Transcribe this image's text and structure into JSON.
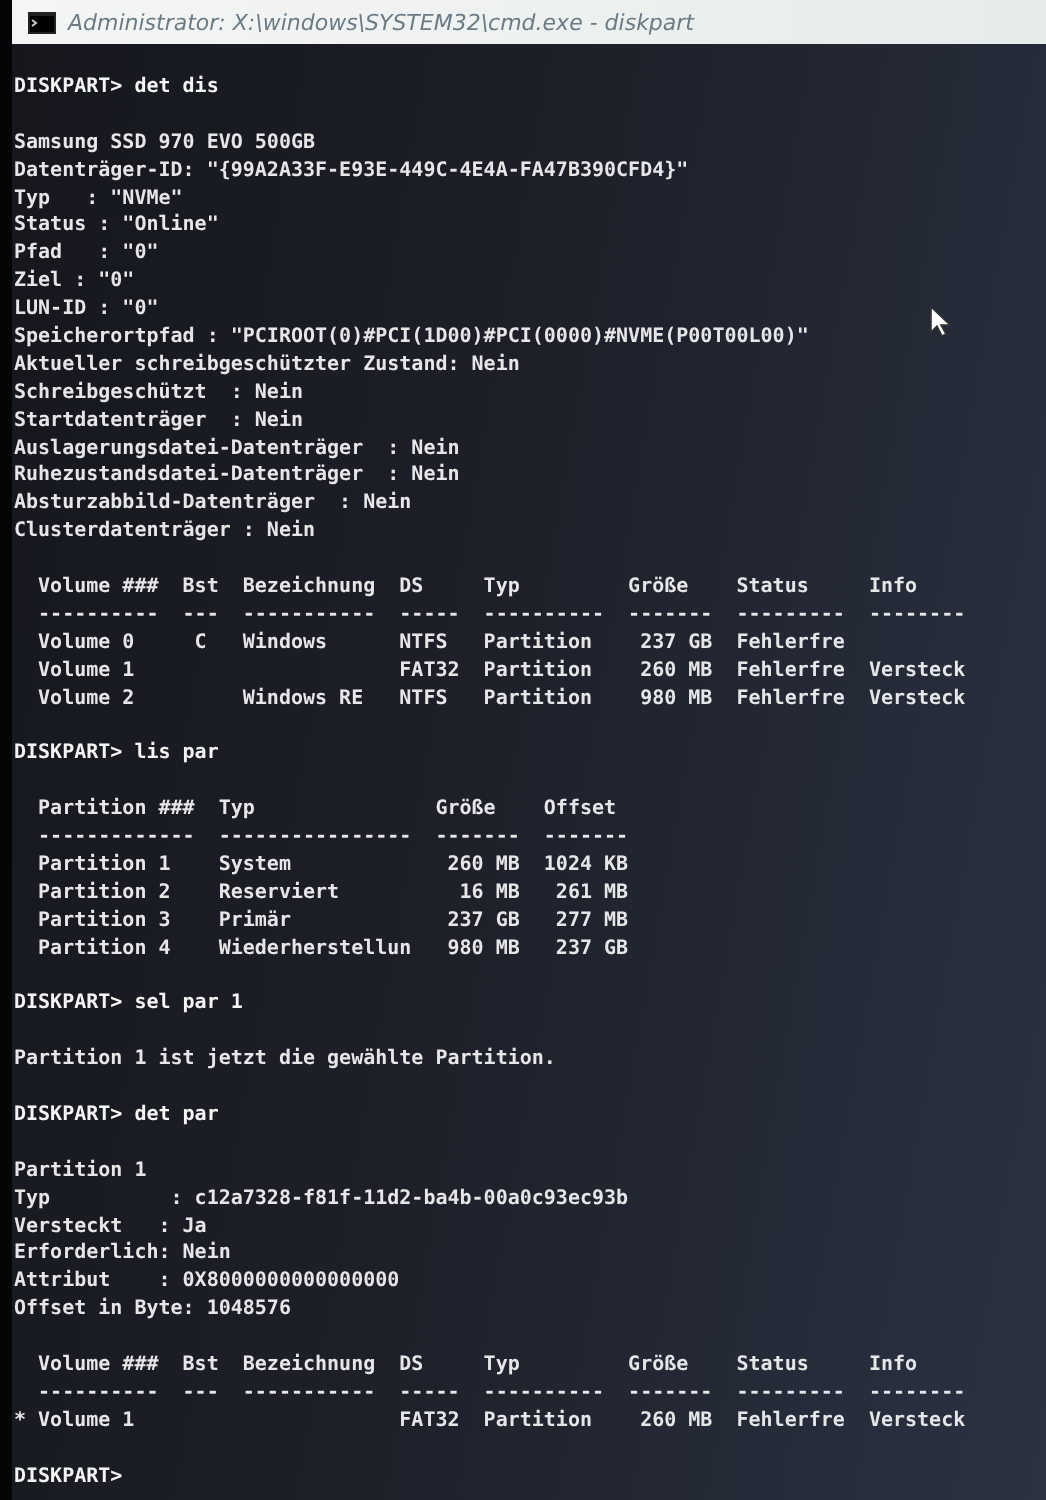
{
  "window": {
    "title": "Administrator: X:\\windows\\SYSTEM32\\cmd.exe - diskpart"
  },
  "console": [
    {
      "kind": "command",
      "lines": [
        "DISKPART> det dis"
      ]
    },
    {
      "kind": "output",
      "lines": [
        "Samsung SSD 970 EVO 500GB",
        "Datenträger-ID: \"{99A2A33F-E93E-449C-4E4A-FA47B390CFD4}\"",
        "Typ   : \"NVMe\"",
        "Status : \"Online\"",
        "Pfad   : \"0\"",
        "Ziel : \"0\"",
        "LUN-ID : \"0\"",
        "Speicherortpfad : \"PCIROOT(0)#PCI(1D00)#PCI(0000)#NVME(P00T00L00)\"",
        "Aktueller schreibgeschützter Zustand: Nein",
        "Schreibgeschützt  : Nein",
        "Startdatenträger  : Nein",
        "Auslagerungsdatei-Datenträger  : Nein",
        "Ruhezustandsdatei-Datenträger  : Nein",
        "Absturzabbild-Datenträger  : Nein",
        "Clusterdatenträger : Nein"
      ]
    },
    {
      "kind": "output",
      "lines": [
        "  Volume ###  Bst  Bezeichnung  DS     Typ         Größe    Status     Info",
        "  ----------  ---  -----------  -----  ----------  -------  ---------  --------",
        "  Volume 0     C   Windows      NTFS   Partition    237 GB  Fehlerfre",
        "  Volume 1                      FAT32  Partition    260 MB  Fehlerfre  Versteck",
        "  Volume 2         Windows RE   NTFS   Partition    980 MB  Fehlerfre  Versteck"
      ]
    },
    {
      "kind": "command",
      "lines": [
        "DISKPART> lis par"
      ]
    },
    {
      "kind": "output",
      "lines": [
        "  Partition ###  Typ               Größe    Offset",
        "  -------------  ----------------  -------  -------",
        "  Partition 1    System             260 MB  1024 KB",
        "  Partition 2    Reserviert          16 MB   261 MB",
        "  Partition 3    Primär             237 GB   277 MB",
        "  Partition 4    Wiederherstellun   980 MB   237 GB"
      ]
    },
    {
      "kind": "command",
      "lines": [
        "DISKPART> sel par 1"
      ]
    },
    {
      "kind": "output",
      "lines": [
        "Partition 1 ist jetzt die gewählte Partition."
      ]
    },
    {
      "kind": "command",
      "lines": [
        "DISKPART> det par"
      ]
    },
    {
      "kind": "output",
      "lines": [
        "Partition 1",
        "Typ          : c12a7328-f81f-11d2-ba4b-00a0c93ec93b",
        "Versteckt   : Ja",
        "Erforderlich: Nein",
        "Attribut    : 0X8000000000000000",
        "Offset in Byte: 1048576"
      ]
    },
    {
      "kind": "output",
      "lines": [
        "  Volume ###  Bst  Bezeichnung  DS     Typ         Größe    Status     Info",
        "  ----------  ---  -----------  -----  ----------  -------  ---------  --------",
        "* Volume 1                      FAT32  Partition    260 MB  Fehlerfre  Versteck"
      ]
    },
    {
      "kind": "command",
      "lines": [
        "DISKPART>"
      ]
    }
  ]
}
